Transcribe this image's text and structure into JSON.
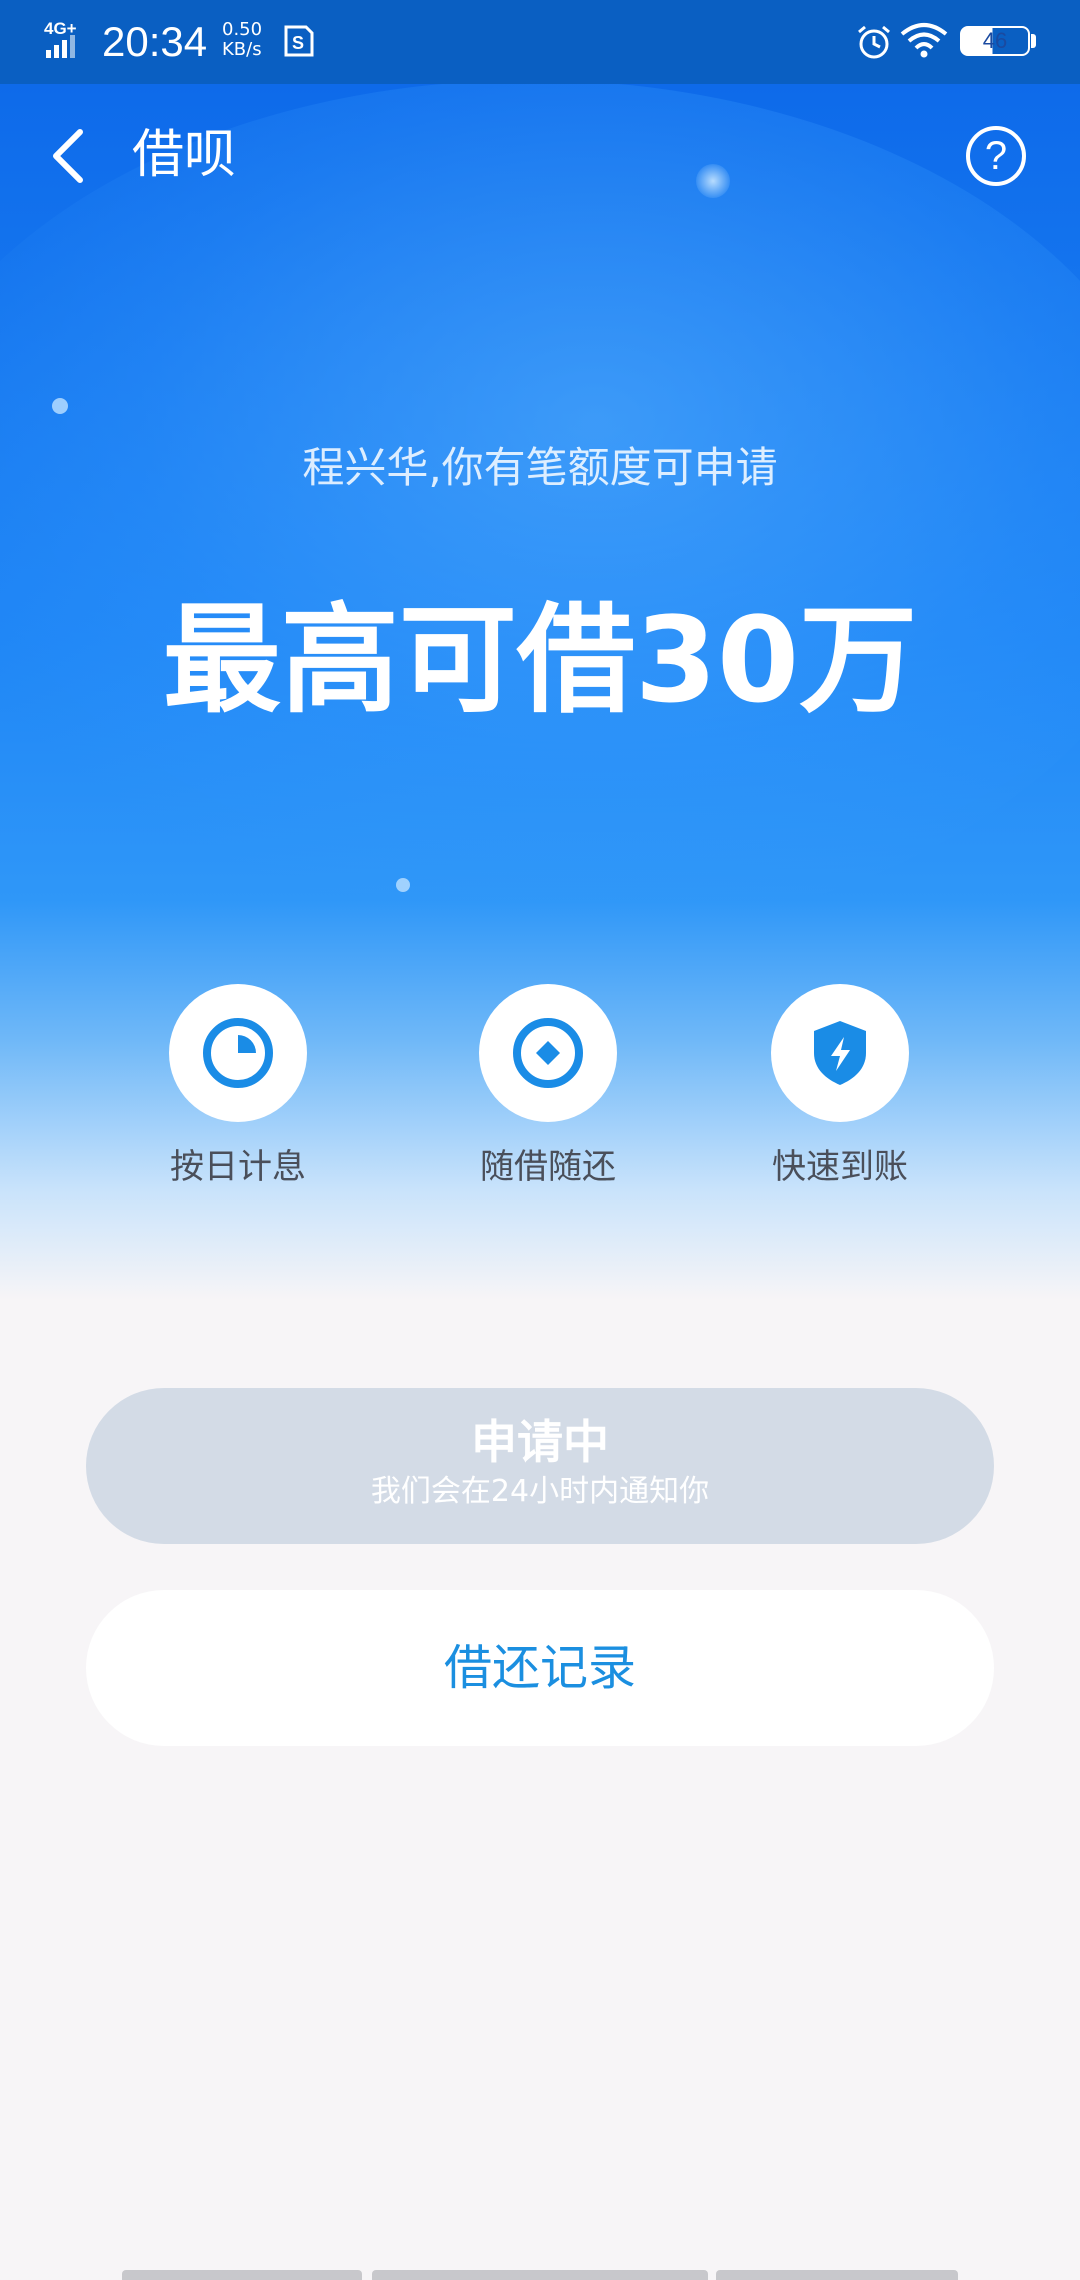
{
  "status_bar": {
    "network": "4G+",
    "time": "20:34",
    "speed_value": "0.50",
    "speed_unit": "KB/s",
    "battery": "46",
    "icons": [
      "signal-icon",
      "sim-icon",
      "alarm-icon",
      "wifi-icon",
      "battery-icon"
    ]
  },
  "header": {
    "title": "借呗",
    "back_icon": "chevron-left-icon",
    "help_icon": "question-icon",
    "help_glyph": "?"
  },
  "hero": {
    "greeting": "程兴华,你有笔额度可申请",
    "headline": "最高可借30万"
  },
  "features": [
    {
      "label": "按日计息",
      "icon": "clock-icon"
    },
    {
      "label": "随借随还",
      "icon": "coin-icon"
    },
    {
      "label": "快速到账",
      "icon": "shield-lightning-icon"
    }
  ],
  "apply_button": {
    "title": "申请中",
    "subtitle": "我们会在24小时内通知你"
  },
  "records_button": {
    "label": "借还记录"
  },
  "colors": {
    "status_bar": "#0a5fc2",
    "hero_top": "#0b66e8",
    "hero_mid": "#2f97f8",
    "page_background": "#f7f5f7",
    "icon_blue": "#1a8ce6",
    "apply_button_bg": "#d3dbe6",
    "records_text": "#1b8fe0"
  }
}
